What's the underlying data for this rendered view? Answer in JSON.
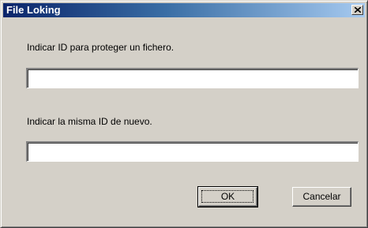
{
  "window": {
    "title": "File Loking",
    "close_symbol": "×",
    "close_icon": "close-icon"
  },
  "form": {
    "prompt_1": "Indicar ID para proteger un fichero.",
    "field_1_value": "",
    "prompt_2": "Indicar la misma ID de nuevo.",
    "field_2_value": ""
  },
  "buttons": {
    "ok_label": "OK",
    "cancel_label": "Cancelar"
  },
  "colors": {
    "title_bar_start": "#0a246a",
    "title_bar_end": "#a6caf0",
    "dialog_face": "#d4d0c8"
  }
}
